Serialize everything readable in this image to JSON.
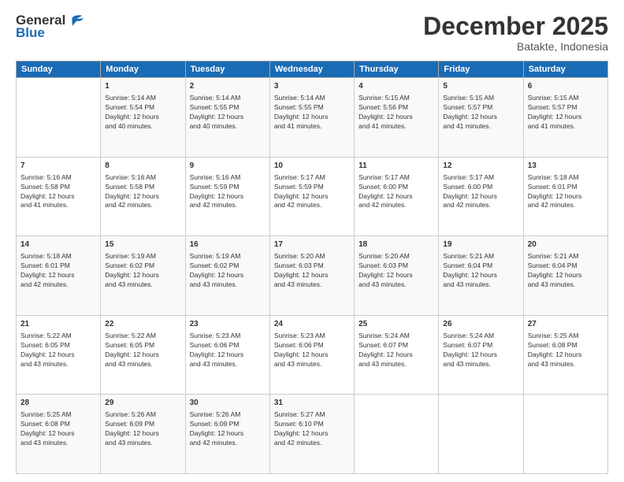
{
  "logo": {
    "line1": "General",
    "line2": "Blue"
  },
  "title": "December 2025",
  "subtitle": "Batakte, Indonesia",
  "days_of_week": [
    "Sunday",
    "Monday",
    "Tuesday",
    "Wednesday",
    "Thursday",
    "Friday",
    "Saturday"
  ],
  "weeks": [
    [
      {
        "day": "",
        "info": ""
      },
      {
        "day": "1",
        "info": "Sunrise: 5:14 AM\nSunset: 5:54 PM\nDaylight: 12 hours\nand 40 minutes."
      },
      {
        "day": "2",
        "info": "Sunrise: 5:14 AM\nSunset: 5:55 PM\nDaylight: 12 hours\nand 40 minutes."
      },
      {
        "day": "3",
        "info": "Sunrise: 5:14 AM\nSunset: 5:55 PM\nDaylight: 12 hours\nand 41 minutes."
      },
      {
        "day": "4",
        "info": "Sunrise: 5:15 AM\nSunset: 5:56 PM\nDaylight: 12 hours\nand 41 minutes."
      },
      {
        "day": "5",
        "info": "Sunrise: 5:15 AM\nSunset: 5:57 PM\nDaylight: 12 hours\nand 41 minutes."
      },
      {
        "day": "6",
        "info": "Sunrise: 5:15 AM\nSunset: 5:57 PM\nDaylight: 12 hours\nand 41 minutes."
      }
    ],
    [
      {
        "day": "7",
        "info": "Sunrise: 5:16 AM\nSunset: 5:58 PM\nDaylight: 12 hours\nand 41 minutes."
      },
      {
        "day": "8",
        "info": "Sunrise: 5:16 AM\nSunset: 5:58 PM\nDaylight: 12 hours\nand 42 minutes."
      },
      {
        "day": "9",
        "info": "Sunrise: 5:16 AM\nSunset: 5:59 PM\nDaylight: 12 hours\nand 42 minutes."
      },
      {
        "day": "10",
        "info": "Sunrise: 5:17 AM\nSunset: 5:59 PM\nDaylight: 12 hours\nand 42 minutes."
      },
      {
        "day": "11",
        "info": "Sunrise: 5:17 AM\nSunset: 6:00 PM\nDaylight: 12 hours\nand 42 minutes."
      },
      {
        "day": "12",
        "info": "Sunrise: 5:17 AM\nSunset: 6:00 PM\nDaylight: 12 hours\nand 42 minutes."
      },
      {
        "day": "13",
        "info": "Sunrise: 5:18 AM\nSunset: 6:01 PM\nDaylight: 12 hours\nand 42 minutes."
      }
    ],
    [
      {
        "day": "14",
        "info": "Sunrise: 5:18 AM\nSunset: 6:01 PM\nDaylight: 12 hours\nand 42 minutes."
      },
      {
        "day": "15",
        "info": "Sunrise: 5:19 AM\nSunset: 6:02 PM\nDaylight: 12 hours\nand 43 minutes."
      },
      {
        "day": "16",
        "info": "Sunrise: 5:19 AM\nSunset: 6:02 PM\nDaylight: 12 hours\nand 43 minutes."
      },
      {
        "day": "17",
        "info": "Sunrise: 5:20 AM\nSunset: 6:03 PM\nDaylight: 12 hours\nand 43 minutes."
      },
      {
        "day": "18",
        "info": "Sunrise: 5:20 AM\nSunset: 6:03 PM\nDaylight: 12 hours\nand 43 minutes."
      },
      {
        "day": "19",
        "info": "Sunrise: 5:21 AM\nSunset: 6:04 PM\nDaylight: 12 hours\nand 43 minutes."
      },
      {
        "day": "20",
        "info": "Sunrise: 5:21 AM\nSunset: 6:04 PM\nDaylight: 12 hours\nand 43 minutes."
      }
    ],
    [
      {
        "day": "21",
        "info": "Sunrise: 5:22 AM\nSunset: 6:05 PM\nDaylight: 12 hours\nand 43 minutes."
      },
      {
        "day": "22",
        "info": "Sunrise: 5:22 AM\nSunset: 6:05 PM\nDaylight: 12 hours\nand 43 minutes."
      },
      {
        "day": "23",
        "info": "Sunrise: 5:23 AM\nSunset: 6:06 PM\nDaylight: 12 hours\nand 43 minutes."
      },
      {
        "day": "24",
        "info": "Sunrise: 5:23 AM\nSunset: 6:06 PM\nDaylight: 12 hours\nand 43 minutes."
      },
      {
        "day": "25",
        "info": "Sunrise: 5:24 AM\nSunset: 6:07 PM\nDaylight: 12 hours\nand 43 minutes."
      },
      {
        "day": "26",
        "info": "Sunrise: 5:24 AM\nSunset: 6:07 PM\nDaylight: 12 hours\nand 43 minutes."
      },
      {
        "day": "27",
        "info": "Sunrise: 5:25 AM\nSunset: 6:08 PM\nDaylight: 12 hours\nand 43 minutes."
      }
    ],
    [
      {
        "day": "28",
        "info": "Sunrise: 5:25 AM\nSunset: 6:08 PM\nDaylight: 12 hours\nand 43 minutes."
      },
      {
        "day": "29",
        "info": "Sunrise: 5:26 AM\nSunset: 6:09 PM\nDaylight: 12 hours\nand 43 minutes."
      },
      {
        "day": "30",
        "info": "Sunrise: 5:26 AM\nSunset: 6:09 PM\nDaylight: 12 hours\nand 42 minutes."
      },
      {
        "day": "31",
        "info": "Sunrise: 5:27 AM\nSunset: 6:10 PM\nDaylight: 12 hours\nand 42 minutes."
      },
      {
        "day": "",
        "info": ""
      },
      {
        "day": "",
        "info": ""
      },
      {
        "day": "",
        "info": ""
      }
    ]
  ]
}
